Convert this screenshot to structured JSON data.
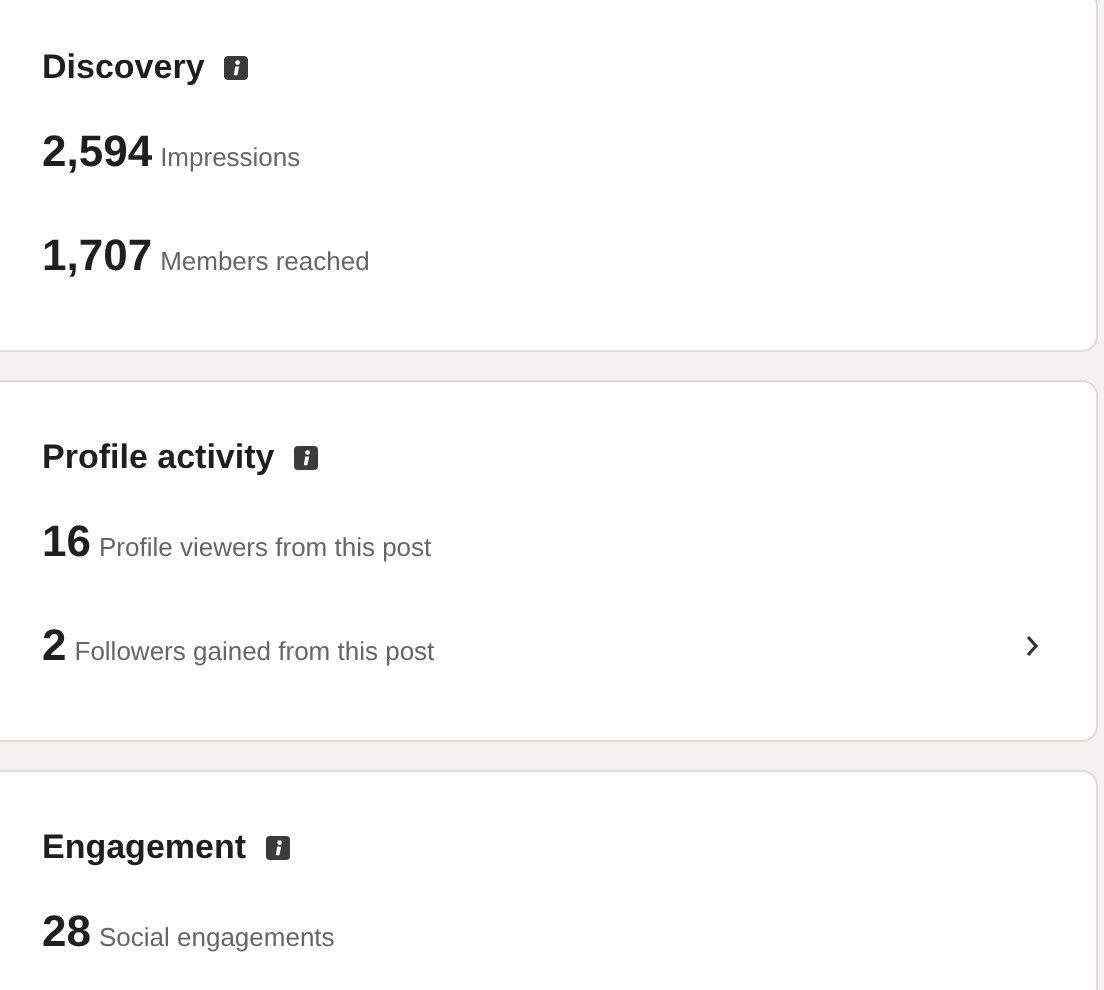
{
  "cards": [
    {
      "title": "Discovery",
      "stats": [
        {
          "value": "2,594",
          "label": "Impressions",
          "link": false
        },
        {
          "value": "1,707",
          "label": "Members reached",
          "link": false
        }
      ]
    },
    {
      "title": "Profile activity",
      "stats": [
        {
          "value": "16",
          "label": "Profile viewers from this post",
          "link": false
        },
        {
          "value": "2",
          "label": "Followers gained from this post",
          "link": true
        }
      ]
    },
    {
      "title": "Engagement",
      "stats": [
        {
          "value": "28",
          "label": "Social engagements",
          "link": false
        }
      ]
    }
  ]
}
